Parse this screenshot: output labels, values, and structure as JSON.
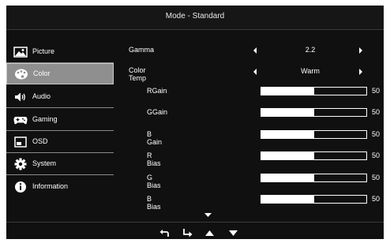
{
  "header": {
    "title": "Mode - Standard"
  },
  "sidebar": {
    "items": [
      {
        "label": "Picture",
        "icon": "picture-icon",
        "active": false
      },
      {
        "label": "Color",
        "icon": "palette-icon",
        "active": true
      },
      {
        "label": "Audio",
        "icon": "speaker-icon",
        "active": false
      },
      {
        "label": "Gaming",
        "icon": "gamepad-icon",
        "active": false
      },
      {
        "label": "OSD",
        "icon": "osd-window-icon",
        "active": false
      },
      {
        "label": "System",
        "icon": "gear-icon",
        "active": false
      },
      {
        "label": "Information",
        "icon": "info-icon",
        "active": false
      }
    ]
  },
  "settings": {
    "gamma": {
      "label": "Gamma",
      "value": "2.2"
    },
    "color_temp": {
      "label": "Color Temp",
      "value": "Warm"
    },
    "sliders": [
      {
        "label": "RGain",
        "value": "50",
        "fraction": 0.5
      },
      {
        "label": "GGain",
        "value": "50",
        "fraction": 0.5
      },
      {
        "label": "B Gain",
        "value": "50",
        "fraction": 0.5
      },
      {
        "label": "R Bias",
        "value": "50",
        "fraction": 0.5
      },
      {
        "label": "G Bias",
        "value": "50",
        "fraction": 0.5
      },
      {
        "label": "B Bias",
        "value": "50",
        "fraction": 0.5
      }
    ]
  },
  "footer": {
    "buttons": [
      "back-icon",
      "enter-icon",
      "up-icon",
      "down-icon"
    ]
  },
  "colors": {
    "background": "#101010",
    "active_item": "#8f8f8f",
    "text": "#ffffff"
  }
}
